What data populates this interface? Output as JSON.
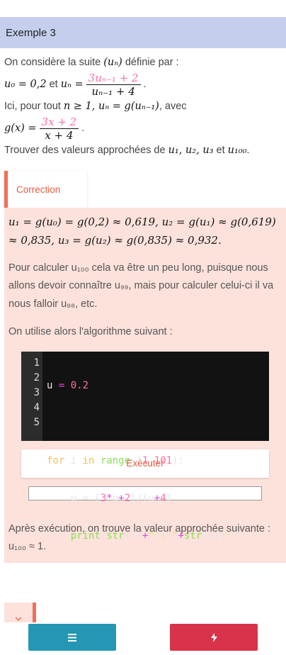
{
  "header": {
    "title": "Exemple 3"
  },
  "intro": {
    "line1": "On considère la suite",
    "seq": "(uₙ)",
    "line1b": "définie par :",
    "u0": "u₀ = 0,2",
    "et": "et",
    "un": "uₙ =",
    "frac_num": "3uₙ₋₁ + 2",
    "frac_den": "uₙ₋₁ + 4",
    "line3a": "Ici, pour tout",
    "cond": "n ≥ 1, uₙ = g(uₙ₋₁)",
    "line3b": ", avec",
    "gx": "g(x) =",
    "g_num": "3x + 2",
    "g_den": "x + 4",
    "task_a": "Trouver des valeurs approchées de",
    "task_vals": "u₁, u₂, u₃",
    "task_b": "et",
    "task_u100": "u₁₀₀"
  },
  "correction": {
    "tab_label": "Correction",
    "math_line": "u₁ = g(u₀) = g(0,2) ≈ 0,619, u₂ = g(u₁) ≈ g(0,619) ≈ 0,835, u₃ = g(u₂) ≈ g(0,835) ≈ 0,932.",
    "para1": "Pour calculer u₁₀₀ cela va être un peu long, puisque nous allons devoir connaître u₉₉, mais pour calculer celui-ci il va nous falloir u₉₈, etc.",
    "para2": "On utilise alors l'algorithme suivant :",
    "code_lines": [
      "1",
      "2",
      "3",
      "4",
      "5"
    ],
    "execute_label": "Exécuter",
    "result": "Après exécution, on trouve la valeur approchée suivante : u₁₀₀ ≈ 1."
  },
  "code": {
    "l1a": "u ",
    "l1op": "=",
    "l1num": " 0.2",
    "l3kw1": "for",
    "l3v": " i ",
    "l3kw2": "in",
    "l3fn": " range",
    "l3p": " (",
    "l3n1": "1",
    "l3c": ",",
    "l3n2": "101",
    "l3e": "):",
    "l4": "    u = (",
    "l4n1": "3",
    "l4op": "*",
    "l4b": "u",
    "l4op2": "+",
    "l4n2": "2",
    "l4c": ")/(u",
    "l4op3": "+",
    "l4n3": "4",
    "l4d": ")",
    "l5": "    ",
    "l5fn": "print",
    "l5a": "(",
    "l5fn2": "str",
    "l5b": "(i)",
    "l5op": "+",
    "l5s": "\" : \"",
    "l5op2": "+",
    "l5fn3": "str",
    "l5c": "(u))"
  },
  "icons": {
    "collapse": "chevron-down-icon",
    "menu": "menu-icon",
    "bolt": "bolt-icon"
  },
  "colors": {
    "accent": "#ef6f57",
    "menu_button": "#2597b5",
    "bolt_button": "#d8334a",
    "header_bg": "#c5cfed"
  }
}
